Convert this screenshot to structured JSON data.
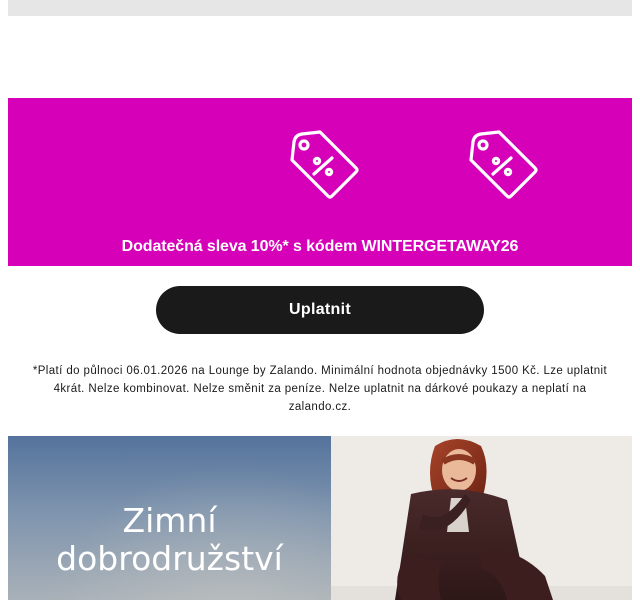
{
  "promo": {
    "text": "Dodatečná sleva 10%* s kódem WINTERGETAWAY26",
    "background_color": "#d600b8",
    "icons": [
      "percent-tag-icon",
      "percent-tag-icon"
    ]
  },
  "cta": {
    "label": "Uplatnit",
    "background_color": "#1a1a1a"
  },
  "disclaimer": {
    "text": "*Platí do půlnoci 06.01.2026 na Lounge by Zalando. Minimální hodnota objednávky 1500 Kč. Lze uplatnit 4krát. Nelze kombinovat. Nelze směnit za peníze. Nelze uplatnit na dárkové poukazy a neplatí na zalando.cz."
  },
  "hero": {
    "title_line1": "Zimní",
    "title_line2": "dobrodružství"
  }
}
